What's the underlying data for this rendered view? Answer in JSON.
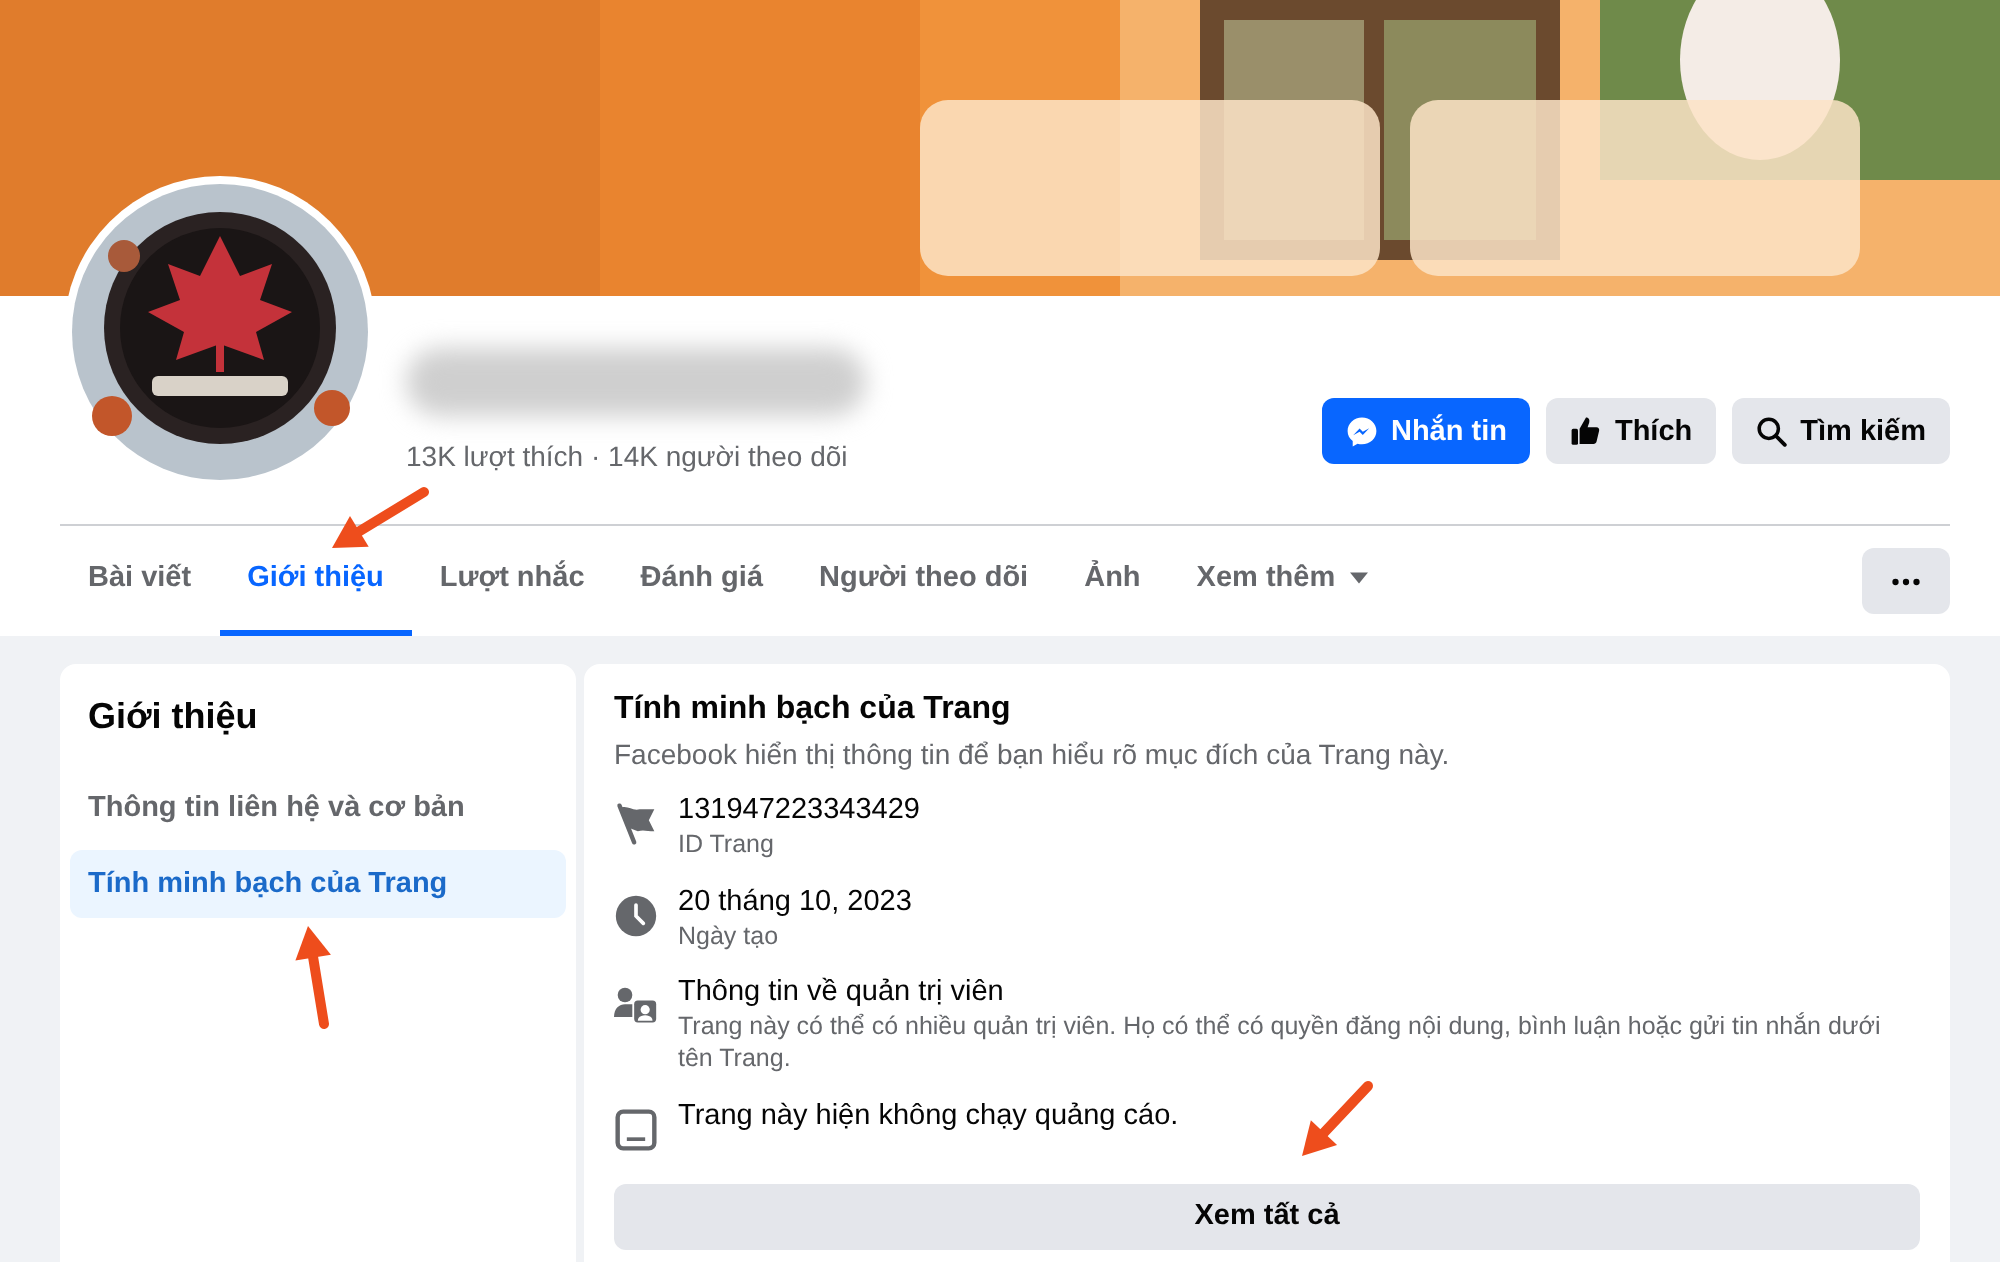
{
  "stats": "13K lượt thích · 14K người theo dõi",
  "actions": [
    {
      "label": "Nhắn tin",
      "kind": "primary"
    },
    {
      "label": "Thích",
      "kind": "secondary"
    },
    {
      "label": "Tìm kiếm",
      "kind": "secondary"
    }
  ],
  "tabs": [
    {
      "label": "Bài viết",
      "selected": false,
      "dropdown": false
    },
    {
      "label": "Giới thiệu",
      "selected": true,
      "dropdown": false
    },
    {
      "label": "Lượt nhắc",
      "selected": false,
      "dropdown": false
    },
    {
      "label": "Đánh giá",
      "selected": false,
      "dropdown": false
    },
    {
      "label": "Người theo dõi",
      "selected": false,
      "dropdown": false
    },
    {
      "label": "Ảnh",
      "selected": false,
      "dropdown": false
    },
    {
      "label": "Xem thêm",
      "selected": false,
      "dropdown": true
    }
  ],
  "sidebar": {
    "title": "Giới thiệu",
    "items": [
      {
        "label": "Thông tin liên hệ và cơ bản",
        "selected": false
      },
      {
        "label": "Tính minh bạch của Trang",
        "selected": true
      }
    ]
  },
  "transparency": {
    "title": "Tính minh bạch của Trang",
    "subtitle": "Facebook hiển thị thông tin để bạn hiểu rõ mục đích của Trang này.",
    "rows": [
      {
        "primary": "131947223343429",
        "secondary": "ID Trang"
      },
      {
        "primary": "20 tháng 10, 2023",
        "secondary": "Ngày tạo"
      },
      {
        "primary": "Thông tin về quản trị viên",
        "secondary": "Trang này có thể có nhiều quản trị viên. Họ có thể có quyền đăng nội dung, bình luận hoặc gửi tin nhắn dưới tên Trang."
      },
      {
        "primary": "Trang này hiện không chạy quảng cáo."
      }
    ],
    "button": "Xem tất cả"
  },
  "annotations": [
    {
      "kind": "arrow"
    },
    {
      "kind": "arrow"
    },
    {
      "kind": "arrow"
    }
  ]
}
